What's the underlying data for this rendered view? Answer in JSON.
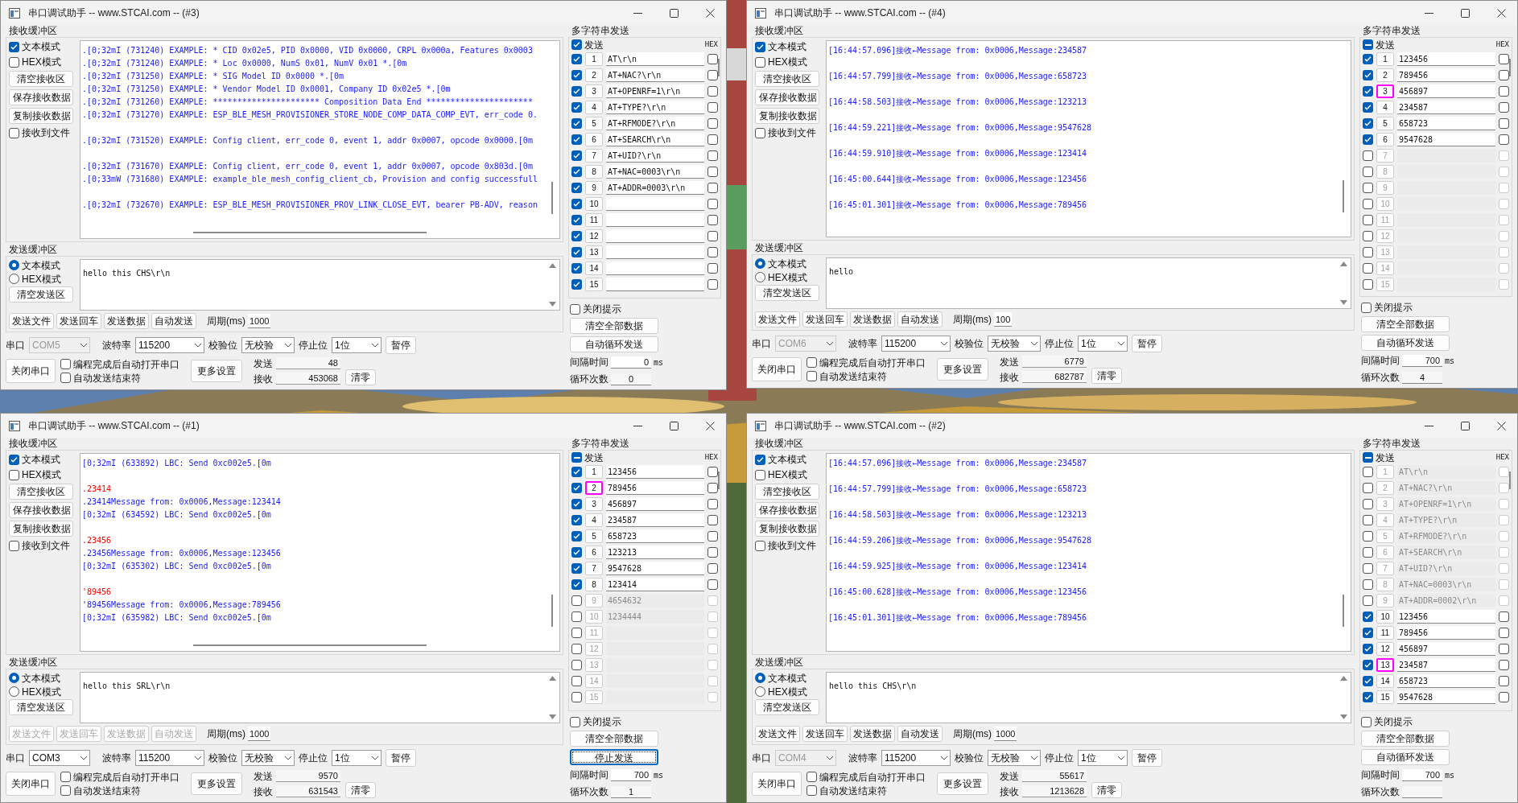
{
  "windows": [
    {
      "title": "串口调试助手 -- www.STCAI.com -- (#3)",
      "receive": {
        "label": "接收缓冲区",
        "modes": [
          {
            "label": "文本模式",
            "checked": true
          },
          {
            "label": "HEX模式",
            "checked": false
          }
        ],
        "buttons": [
          "清空接收区",
          "保存接收数据",
          "复制接收数据"
        ],
        "to_file": {
          "label": "接收到文件",
          "checked": false
        },
        "blocks": [
          [
            {
              "text": ".[0;32mI (731240) EXAMPLE: * CID 0x02e5, PID 0x0000, VID 0x0000, CRPL 0x000a, Features 0x0003",
              "color": "#1a1aff"
            },
            {
              "text": ".[0;32mI (731240) EXAMPLE: * Loc 0x0000, NumS 0x01, NumV 0x01 *.[0m",
              "color": "#1a1aff"
            },
            {
              "text": ".[0;32mI (731250) EXAMPLE: * SIG Model ID 0x0000 *.[0m",
              "color": "#1a1aff"
            },
            {
              "text": ".[0;32mI (731250) EXAMPLE: * Vendor Model ID 0x0001, Company ID 0x02e5 *.[0m",
              "color": "#1a1aff"
            },
            {
              "text": ".[0;32mI (731260) EXAMPLE: ********************** Composition Data End **********************",
              "color": "#1a1aff"
            },
            {
              "text": ".[0;32mI (731270) EXAMPLE: ESP_BLE_MESH_PROVISIONER_STORE_NODE_COMP_DATA_COMP_EVT, err_code 0.",
              "color": "#1a1aff"
            }
          ],
          [
            {
              "text": ".[0;32mI (731520) EXAMPLE: Config client, err_code 0, event 1, addr 0x0007, opcode 0x0000.[0m",
              "color": "#1a1aff"
            }
          ],
          [
            {
              "text": ".[0;32mI (731670) EXAMPLE: Config client, err_code 0, event 1, addr 0x0007, opcode 0x803d.[0m",
              "color": "#1a1aff"
            },
            {
              "text": ".[0;33mW (731680) EXAMPLE: example_ble_mesh_config_client_cb, Provision and config successfull",
              "color": "#1a1aff"
            }
          ],
          [
            {
              "text": ".[0;32mI (732670) EXAMPLE: ESP_BLE_MESH_PROVISIONER_PROV_LINK_CLOSE_EVT, bearer PB-ADV, reason",
              "color": "#1a1aff"
            }
          ]
        ]
      },
      "send": {
        "label": "发送缓冲区",
        "modes": [
          {
            "label": "文本模式",
            "selected": true
          },
          {
            "label": "HEX模式",
            "selected": false
          }
        ],
        "clear": "清空发送区",
        "text": "hello this CHS\\r\\n",
        "actions": [
          {
            "label": "发送文件",
            "disabled": false
          },
          {
            "label": "发送回车",
            "disabled": false
          },
          {
            "label": "发送数据",
            "disabled": false
          },
          {
            "label": "自动发送",
            "disabled": false
          }
        ],
        "period_label": "周期(ms)",
        "period": "1000"
      },
      "port": {
        "port_label": "串口",
        "port": "COM5",
        "port_disabled": true,
        "baud_label": "波特率",
        "baud": "115200",
        "parity_label": "校验位",
        "parity": "无校验",
        "stop_label": "停止位",
        "stop": "1位",
        "pause": "暂停"
      },
      "footer": {
        "close_port": "关闭串口",
        "options": [
          {
            "label": "编程完成后自动打开串口",
            "checked": false
          },
          {
            "label": "自动发送结束符",
            "checked": false
          }
        ],
        "more": "更多设置",
        "sent_label": "发送",
        "sent": "48",
        "recv_label": "接收",
        "recv": "453068",
        "reset": "清零"
      },
      "multi": {
        "title": "多字符串发送",
        "header": {
          "label": "发送",
          "checked": true,
          "partial": false
        },
        "hex_label": "HEX",
        "rows": [
          {
            "num": "1",
            "value": "AT\\r\\n",
            "checked": true,
            "hex": false,
            "focused": false
          },
          {
            "num": "2",
            "value": "AT+NAC?\\r\\n",
            "checked": true,
            "hex": false,
            "focused": false
          },
          {
            "num": "3",
            "value": "AT+OPENRF=1\\r\\n",
            "checked": true,
            "hex": false,
            "focused": false
          },
          {
            "num": "4",
            "value": "AT+TYPE?\\r\\n",
            "checked": true,
            "hex": false,
            "focused": false
          },
          {
            "num": "5",
            "value": "AT+RFMODE?\\r\\n",
            "checked": true,
            "hex": false,
            "focused": false
          },
          {
            "num": "6",
            "value": "AT+SEARCH\\r\\n",
            "checked": true,
            "hex": false,
            "focused": false
          },
          {
            "num": "7",
            "value": "AT+UID?\\r\\n",
            "checked": true,
            "hex": false,
            "focused": false
          },
          {
            "num": "8",
            "value": "AT+NAC=0003\\r\\n",
            "checked": true,
            "hex": false,
            "focused": false
          },
          {
            "num": "9",
            "value": "AT+ADDR=0003\\r\\n",
            "checked": true,
            "hex": false,
            "focused": false
          },
          {
            "num": "10",
            "checked": true,
            "hex": false,
            "focused": false
          },
          {
            "num": "11",
            "checked": true,
            "hex": false,
            "focused": false
          },
          {
            "num": "12",
            "checked": true,
            "hex": false,
            "focused": false
          },
          {
            "num": "13",
            "checked": true,
            "hex": false,
            "focused": false
          },
          {
            "num": "14",
            "checked": true,
            "hex": false,
            "focused": false
          },
          {
            "num": "15",
            "checked": true,
            "hex": false,
            "focused": false
          }
        ],
        "mute": {
          "label": "关闭提示",
          "checked": false
        },
        "clear_all": "清空全部数据",
        "loop": {
          "label": "自动循环发送",
          "focused": false
        },
        "interval_label": "间隔时间",
        "interval": "0",
        "interval_unit": "ms",
        "count_label": "循环次数",
        "count": "0"
      }
    },
    {
      "title": "串口调试助手 -- www.STCAI.com -- (#4)",
      "receive": {
        "label": "接收缓冲区",
        "modes": [
          {
            "label": "文本模式",
            "checked": true
          },
          {
            "label": "HEX模式",
            "checked": false
          }
        ],
        "buttons": [
          "清空接收区",
          "保存接收数据",
          "复制接收数据"
        ],
        "to_file": {
          "label": "接收到文件",
          "checked": false
        },
        "blocks": [
          [
            {
              "text": "[16:44:57.096]接收←Message from: 0x0006,Message:234587",
              "color": "#1a1aff"
            }
          ],
          [
            {
              "text": "[16:44:57.799]接收←Message from: 0x0006,Message:658723",
              "color": "#1a1aff"
            }
          ],
          [
            {
              "text": "[16:44:58.503]接收←Message from: 0x0006,Message:123213",
              "color": "#1a1aff"
            }
          ],
          [
            {
              "text": "[16:44:59.221]接收←Message from: 0x0006,Message:9547628",
              "color": "#1a1aff"
            }
          ],
          [
            {
              "text": "[16:44:59.910]接收←Message from: 0x0006,Message:123414",
              "color": "#1a1aff"
            }
          ],
          [
            {
              "text": "[16:45:00.644]接收←Message from: 0x0006,Message:123456",
              "color": "#1a1aff"
            }
          ],
          [
            {
              "text": "[16:45:01.301]接收←Message from: 0x0006,Message:789456",
              "color": "#1a1aff"
            }
          ]
        ]
      },
      "send": {
        "label": "发送缓冲区",
        "modes": [
          {
            "label": "文本模式",
            "selected": true
          },
          {
            "label": "HEX模式",
            "selected": false
          }
        ],
        "clear": "清空发送区",
        "text": "hello",
        "actions": [
          {
            "label": "发送文件",
            "disabled": false
          },
          {
            "label": "发送回车",
            "disabled": false
          },
          {
            "label": "发送数据",
            "disabled": false
          },
          {
            "label": "自动发送",
            "disabled": false
          }
        ],
        "period_label": "周期(ms)",
        "period": "100"
      },
      "port": {
        "port_label": "串口",
        "port": "COM6",
        "port_disabled": true,
        "baud_label": "波特率",
        "baud": "115200",
        "parity_label": "校验位",
        "parity": "无校验",
        "stop_label": "停止位",
        "stop": "1位",
        "pause": "暂停"
      },
      "footer": {
        "close_port": "关闭串口",
        "options": [
          {
            "label": "编程完成后自动打开串口",
            "checked": false
          },
          {
            "label": "自动发送结束符",
            "checked": false
          }
        ],
        "more": "更多设置",
        "sent_label": "发送",
        "sent": "6779",
        "recv_label": "接收",
        "recv": "682787",
        "reset": "清零"
      },
      "multi": {
        "title": "多字符串发送",
        "header": {
          "label": "发送",
          "checked": true,
          "partial": true
        },
        "hex_label": "HEX",
        "rows": [
          {
            "num": "1",
            "value": "123456",
            "checked": true,
            "hex": false,
            "focused": false
          },
          {
            "num": "2",
            "value": "789456",
            "checked": true,
            "hex": false,
            "focused": false
          },
          {
            "num": "3",
            "value": "456897",
            "checked": true,
            "hex": false,
            "focused": true
          },
          {
            "num": "4",
            "value": "234587",
            "checked": true,
            "hex": false,
            "focused": false
          },
          {
            "num": "5",
            "value": "658723",
            "checked": true,
            "hex": false,
            "focused": false
          },
          {
            "num": "6",
            "value": "9547628",
            "checked": true,
            "hex": false,
            "focused": false
          },
          {
            "num": "7",
            "checked": false,
            "hex": false,
            "focused": false
          },
          {
            "num": "8",
            "checked": false,
            "hex": false,
            "focused": false
          },
          {
            "num": "9",
            "checked": false,
            "hex": false,
            "focused": false
          },
          {
            "num": "10",
            "checked": false,
            "hex": false,
            "focused": false
          },
          {
            "num": "11",
            "checked": false,
            "hex": false,
            "focused": false
          },
          {
            "num": "12",
            "checked": false,
            "hex": false,
            "focused": false
          },
          {
            "num": "13",
            "checked": false,
            "hex": false,
            "focused": false
          },
          {
            "num": "14",
            "checked": false,
            "hex": false,
            "focused": false
          },
          {
            "num": "15",
            "checked": false,
            "hex": false,
            "focused": false
          }
        ],
        "mute": {
          "label": "关闭提示",
          "checked": false
        },
        "clear_all": "清空全部数据",
        "loop": {
          "label": "自动循环发送",
          "focused": false
        },
        "interval_label": "间隔时间",
        "interval": "700",
        "interval_unit": "ms",
        "count_label": "循环次数",
        "count": "4"
      }
    },
    {
      "title": "串口调试助手 -- www.STCAI.com -- (#1)",
      "receive": {
        "label": "接收缓冲区",
        "modes": [
          {
            "label": "文本模式",
            "checked": true
          },
          {
            "label": "HEX模式",
            "checked": false
          }
        ],
        "buttons": [
          "清空接收区",
          "保存接收数据",
          "复制接收数据"
        ],
        "to_file": {
          "label": "接收到文件",
          "checked": false
        },
        "blocks": [
          [
            {
              "text": "[0;32mI (633892) LBC: Send 0xc002e5.[0m",
              "color": "#1a1aff"
            }
          ],
          [
            {
              "text": ".23414",
              "color": "#ff0000"
            },
            {
              "text": ".23414Message from: 0x0006,Message:123414",
              "color": "#1a1aff"
            },
            {
              "text": "[0;32mI (634592) LBC: Send 0xc002e5.[0m",
              "color": "#1a1aff"
            }
          ],
          [
            {
              "text": ".23456",
              "color": "#ff0000"
            },
            {
              "text": ".23456Message from: 0x0006,Message:123456",
              "color": "#1a1aff"
            },
            {
              "text": "[0;32mI (635302) LBC: Send 0xc002e5.[0m",
              "color": "#1a1aff"
            }
          ],
          [
            {
              "text": "'89456",
              "color": "#ff0000"
            },
            {
              "text": "'89456Message from: 0x0006,Message:789456",
              "color": "#1a1aff"
            },
            {
              "text": "[0;32mI (635982) LBC: Send 0xc002e5.[0m",
              "color": "#1a1aff"
            }
          ]
        ]
      },
      "send": {
        "label": "发送缓冲区",
        "modes": [
          {
            "label": "文本模式",
            "selected": true
          },
          {
            "label": "HEX模式",
            "selected": false
          }
        ],
        "clear": "清空发送区",
        "text": "hello this SRL\\r\\n",
        "actions": [
          {
            "label": "发送文件",
            "disabled": true
          },
          {
            "label": "发送回车",
            "disabled": true
          },
          {
            "label": "发送数据",
            "disabled": true
          },
          {
            "label": "自动发送",
            "disabled": true
          }
        ],
        "period_label": "周期(ms)",
        "period": "1000"
      },
      "port": {
        "port_label": "串口",
        "port": "COM3",
        "port_disabled": false,
        "baud_label": "波特率",
        "baud": "115200",
        "parity_label": "校验位",
        "parity": "无校验",
        "stop_label": "停止位",
        "stop": "1位",
        "pause": "暂停"
      },
      "footer": {
        "close_port": "关闭串口",
        "options": [
          {
            "label": "编程完成后自动打开串口",
            "checked": false
          },
          {
            "label": "自动发送结束符",
            "checked": false
          }
        ],
        "more": "更多设置",
        "sent_label": "发送",
        "sent": "9570",
        "recv_label": "接收",
        "recv": "631543",
        "reset": "清零"
      },
      "multi": {
        "title": "多字符串发送",
        "header": {
          "label": "发送",
          "checked": true,
          "partial": true
        },
        "hex_label": "HEX",
        "rows": [
          {
            "num": "1",
            "value": "123456",
            "checked": true,
            "hex": false,
            "focused": false
          },
          {
            "num": "2",
            "value": "789456",
            "checked": true,
            "hex": false,
            "focused": true
          },
          {
            "num": "3",
            "value": "456897",
            "checked": true,
            "hex": false,
            "focused": false
          },
          {
            "num": "4",
            "value": "234587",
            "checked": true,
            "hex": false,
            "focused": false
          },
          {
            "num": "5",
            "value": "658723",
            "checked": true,
            "hex": false,
            "focused": false
          },
          {
            "num": "6",
            "value": "123213",
            "checked": true,
            "hex": false,
            "focused": false
          },
          {
            "num": "7",
            "value": "9547628",
            "checked": true,
            "hex": false,
            "focused": false
          },
          {
            "num": "8",
            "value": "123414",
            "checked": true,
            "hex": false,
            "focused": false
          },
          {
            "num": "9",
            "value": "4654632",
            "checked": false,
            "hex": false,
            "focused": false
          },
          {
            "num": "10",
            "value": "1234444",
            "checked": false,
            "hex": false,
            "focused": false
          },
          {
            "num": "11",
            "checked": false,
            "hex": false,
            "focused": false
          },
          {
            "num": "12",
            "checked": false,
            "hex": false,
            "focused": false
          },
          {
            "num": "13",
            "checked": false,
            "hex": false,
            "focused": false
          },
          {
            "num": "14",
            "checked": false,
            "hex": false,
            "focused": false
          },
          {
            "num": "15",
            "checked": false,
            "hex": false,
            "focused": false
          }
        ],
        "mute": {
          "label": "关闭提示",
          "checked": false
        },
        "clear_all": "清空全部数据",
        "loop": {
          "label": "停止发送",
          "focused": true
        },
        "interval_label": "间隔时间",
        "interval": "700",
        "interval_unit": "ms",
        "count_label": "循环次数",
        "count": "1"
      }
    },
    {
      "title": "串口调试助手 -- www.STCAI.com -- (#2)",
      "receive": {
        "label": "接收缓冲区",
        "modes": [
          {
            "label": "文本模式",
            "checked": true
          },
          {
            "label": "HEX模式",
            "checked": false
          }
        ],
        "buttons": [
          "清空接收区",
          "保存接收数据",
          "复制接收数据"
        ],
        "to_file": {
          "label": "接收到文件",
          "checked": false
        },
        "blocks": [
          [
            {
              "text": "[16:44:57.096]接收←Message from: 0x0006,Message:234587",
              "color": "#1a1aff"
            }
          ],
          [
            {
              "text": "[16:44:57.799]接收←Message from: 0x0006,Message:658723",
              "color": "#1a1aff"
            }
          ],
          [
            {
              "text": "[16:44:58.503]接收←Message from: 0x0006,Message:123213",
              "color": "#1a1aff"
            }
          ],
          [
            {
              "text": "[16:44:59.206]接收←Message from: 0x0006,Message:9547628",
              "color": "#1a1aff"
            }
          ],
          [
            {
              "text": "[16:44:59.925]接收←Message from: 0x0006,Message:123414",
              "color": "#1a1aff"
            }
          ],
          [
            {
              "text": "[16:45:00.628]接收←Message from: 0x0006,Message:123456",
              "color": "#1a1aff"
            }
          ],
          [
            {
              "text": "[16:45:01.301]接收←Message from: 0x0006,Message:789456",
              "color": "#1a1aff"
            }
          ]
        ]
      },
      "send": {
        "label": "发送缓冲区",
        "modes": [
          {
            "label": "文本模式",
            "selected": true
          },
          {
            "label": "HEX模式",
            "selected": false
          }
        ],
        "clear": "清空发送区",
        "text": "hello this CHS\\r\\n",
        "actions": [
          {
            "label": "发送文件",
            "disabled": false
          },
          {
            "label": "发送回车",
            "disabled": false
          },
          {
            "label": "发送数据",
            "disabled": false
          },
          {
            "label": "自动发送",
            "disabled": false
          }
        ],
        "period_label": "周期(ms)",
        "period": "1000"
      },
      "port": {
        "port_label": "串口",
        "port": "COM4",
        "port_disabled": true,
        "baud_label": "波特率",
        "baud": "115200",
        "parity_label": "校验位",
        "parity": "无校验",
        "stop_label": "停止位",
        "stop": "1位",
        "pause": "暂停"
      },
      "footer": {
        "close_port": "关闭串口",
        "options": [
          {
            "label": "编程完成后自动打开串口",
            "checked": false
          },
          {
            "label": "自动发送结束符",
            "checked": false
          }
        ],
        "more": "更多设置",
        "sent_label": "发送",
        "sent": "55617",
        "recv_label": "接收",
        "recv": "1213628",
        "reset": "清零"
      },
      "multi": {
        "title": "多字符串发送",
        "header": {
          "label": "发送",
          "checked": true,
          "partial": true
        },
        "hex_label": "HEX",
        "rows": [
          {
            "num": "1",
            "value": "AT\\r\\n",
            "checked": false,
            "hex": false,
            "focused": false
          },
          {
            "num": "2",
            "value": "AT+NAC?\\r\\n",
            "checked": false,
            "hex": false,
            "focused": false
          },
          {
            "num": "3",
            "value": "AT+OPENRF=1\\r\\n",
            "checked": false,
            "hex": false,
            "focused": false
          },
          {
            "num": "4",
            "value": "AT+TYPE?\\r\\n",
            "checked": false,
            "hex": false,
            "focused": false
          },
          {
            "num": "5",
            "value": "AT+RFMODE?\\r\\n",
            "checked": false,
            "hex": false,
            "focused": false
          },
          {
            "num": "6",
            "value": "AT+SEARCH\\r\\n",
            "checked": false,
            "hex": false,
            "focused": false
          },
          {
            "num": "7",
            "value": "AT+UID?\\r\\n",
            "checked": false,
            "hex": false,
            "focused": false
          },
          {
            "num": "8",
            "value": "AT+NAC=0003\\r\\n",
            "checked": false,
            "hex": false,
            "focused": false
          },
          {
            "num": "9",
            "value": "AT+ADDR=0002\\r\\n",
            "checked": false,
            "hex": false,
            "focused": false
          },
          {
            "num": "10",
            "value": "123456",
            "checked": true,
            "hex": false,
            "focused": false
          },
          {
            "num": "11",
            "value": "789456",
            "checked": true,
            "hex": false,
            "focused": false
          },
          {
            "num": "12",
            "value": "456897",
            "checked": true,
            "hex": false,
            "focused": false
          },
          {
            "num": "13",
            "value": "234587",
            "checked": true,
            "hex": false,
            "focused": true
          },
          {
            "num": "14",
            "value": "658723",
            "checked": true,
            "hex": false,
            "focused": false
          },
          {
            "num": "15",
            "value": "9547628",
            "checked": true,
            "hex": false,
            "focused": false
          }
        ],
        "mute": {
          "label": "关闭提示",
          "checked": false
        },
        "clear_all": "清空全部数据",
        "loop": {
          "label": "自动循环发送",
          "focused": false
        },
        "interval_label": "间隔时间",
        "interval": "700",
        "interval_unit": "ms",
        "count_label": "循环次数"
      }
    }
  ]
}
